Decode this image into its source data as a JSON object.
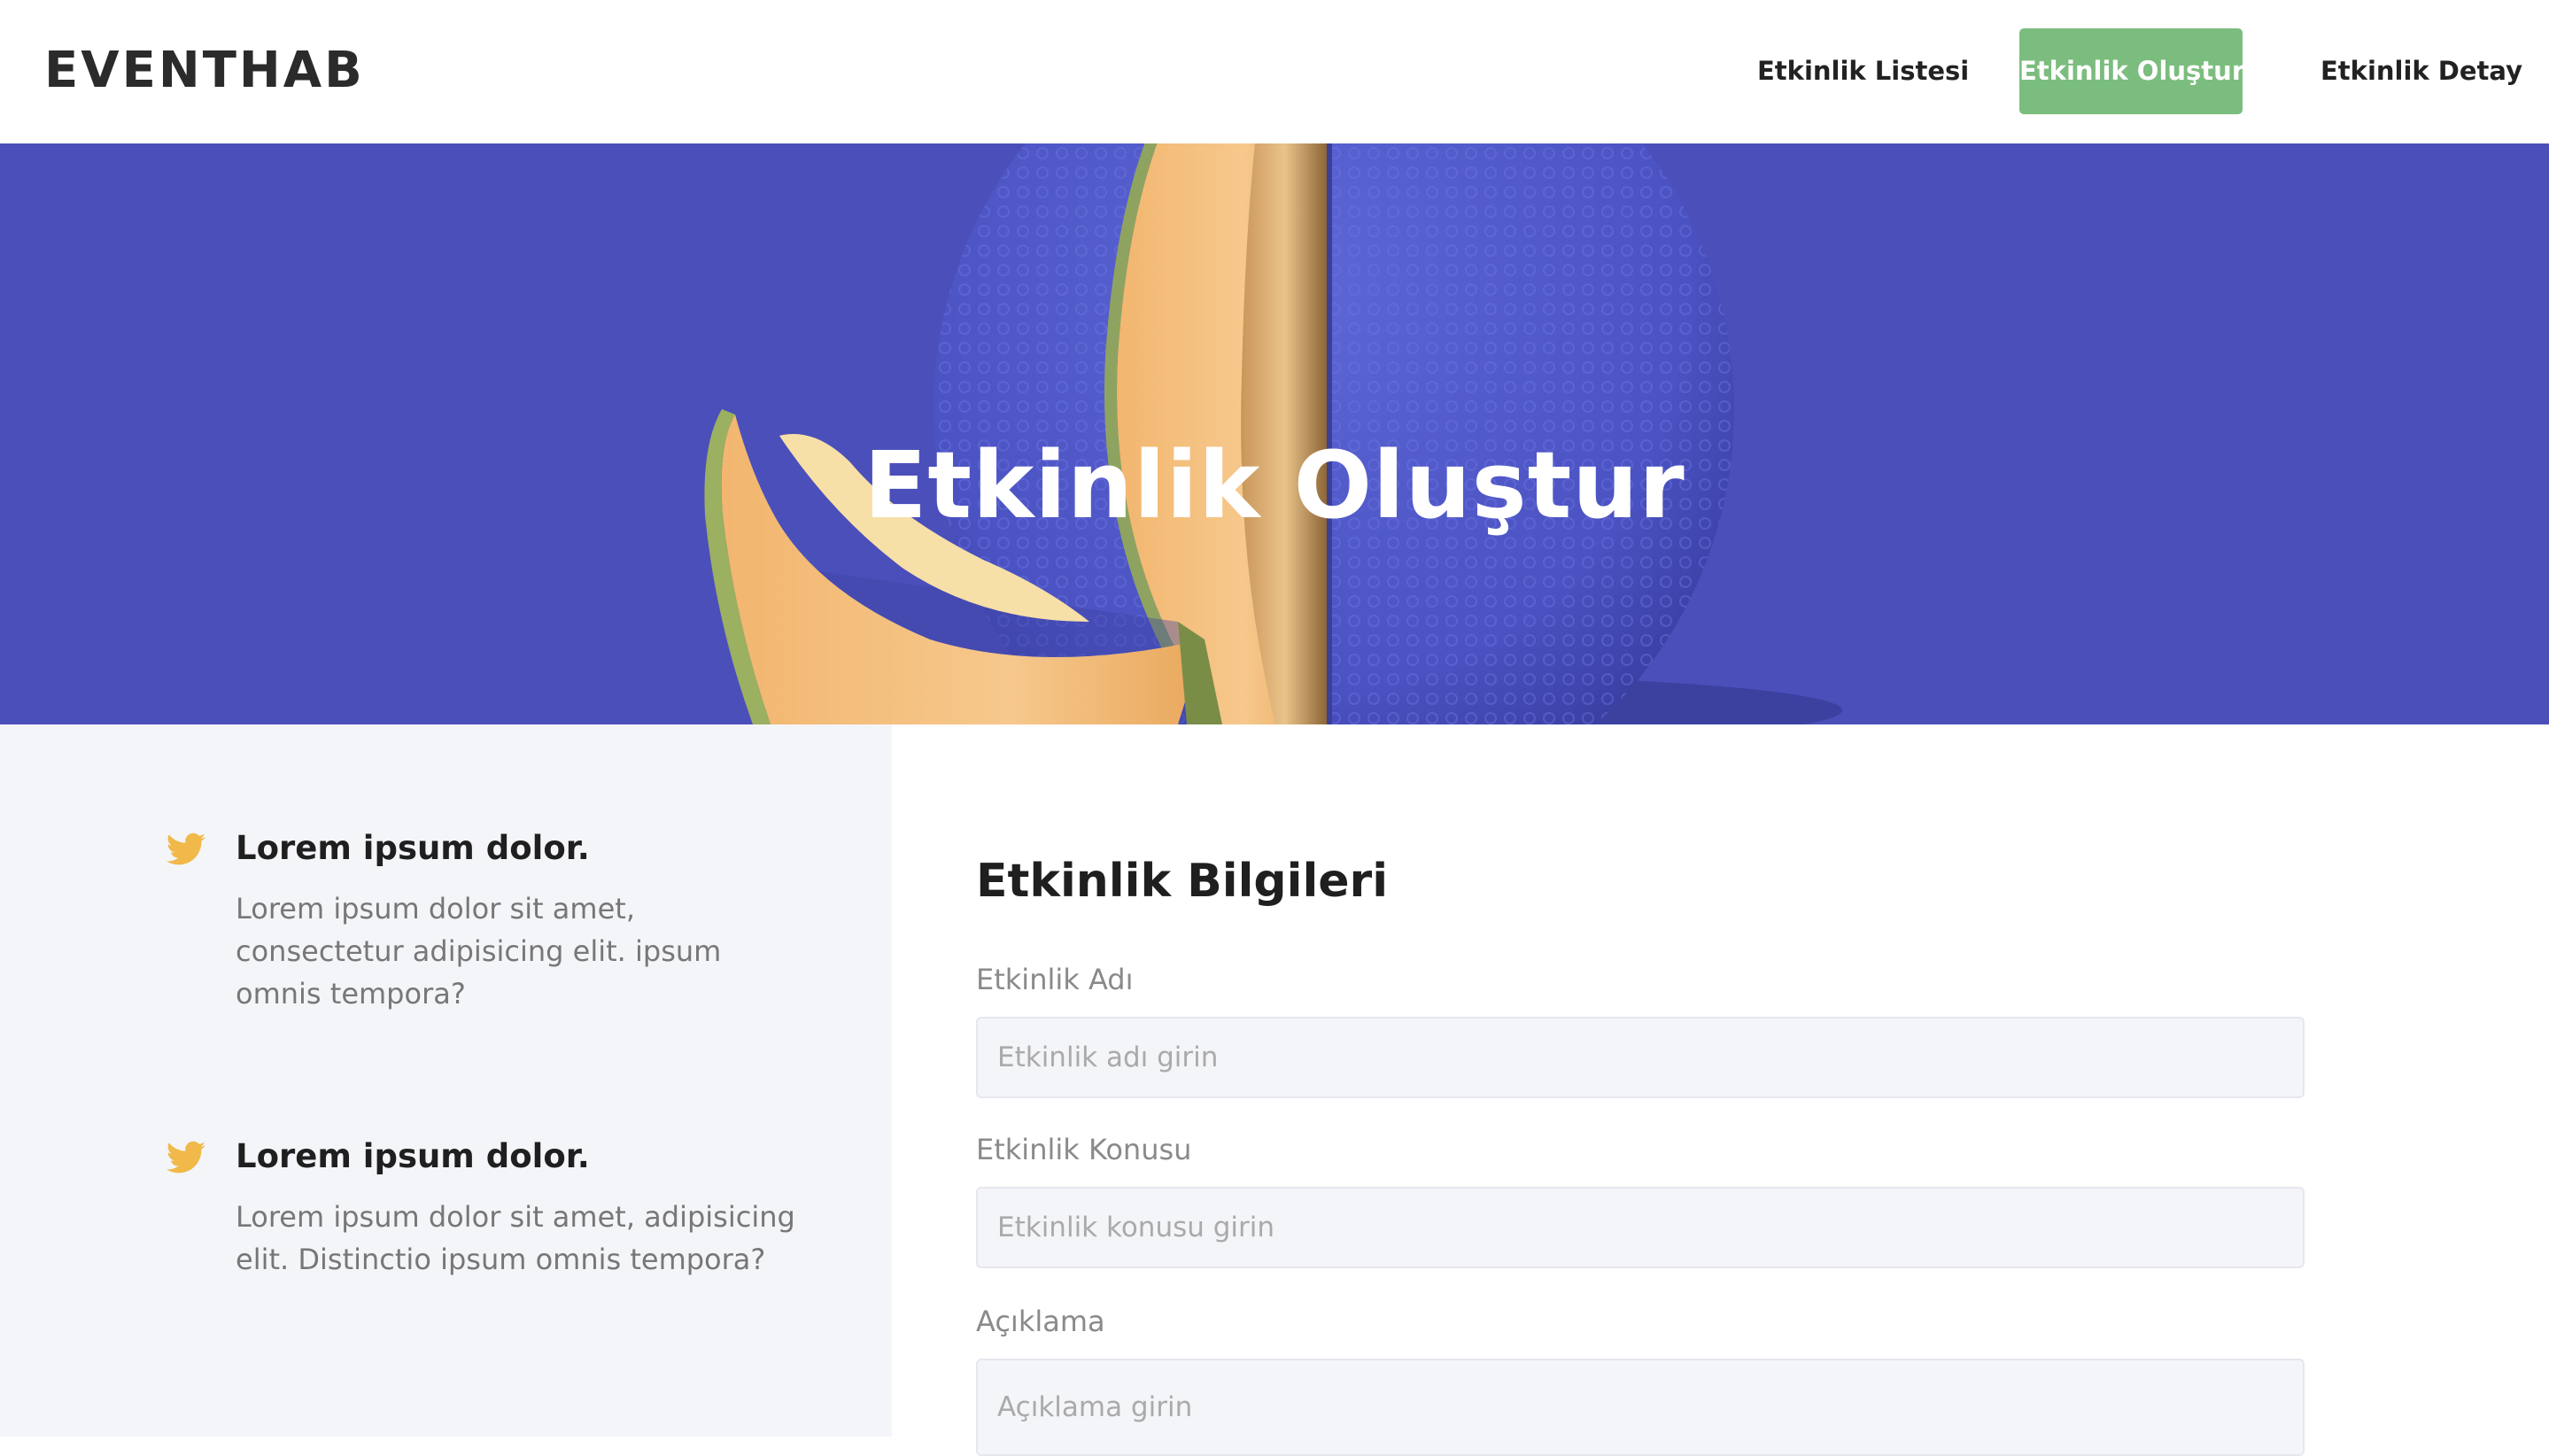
{
  "navbar": {
    "brand": "EVENTHAB",
    "links": [
      {
        "label": "Etkinlik Listesi",
        "active": false
      },
      {
        "label": "Etkinlik Oluştur",
        "active": true
      },
      {
        "label": "Etkinlik Detay",
        "active": false
      }
    ]
  },
  "hero": {
    "title": "Etkinlik Oluştur",
    "background_color": "#4b4fba",
    "image": "cantaloupe-melon-image"
  },
  "features": [
    {
      "icon": "twitter-icon",
      "title": "Lorem ipsum dolor.",
      "text": "Lorem ipsum dolor sit amet, consectetur adipisicing elit. ipsum omnis tempora?"
    },
    {
      "icon": "twitter-icon",
      "title": "Lorem ipsum dolor.",
      "text": "Lorem ipsum dolor sit amet, adipisicing elit. Distinctio ipsum omnis tempora?"
    }
  ],
  "form": {
    "title": "Etkinlik Bilgileri",
    "fields": [
      {
        "label": "Etkinlik Adı",
        "placeholder": "Etkinlik adı girin",
        "value": ""
      },
      {
        "label": "Etkinlik Konusu",
        "placeholder": "Etkinlik konusu girin",
        "value": ""
      },
      {
        "label": "Açıklama",
        "placeholder": "Açıklama girin",
        "value": ""
      }
    ]
  },
  "colors": {
    "accent_green": "#7bbd7e",
    "icon_yellow": "#f0b94a",
    "hero_blue": "#4b4fba"
  }
}
